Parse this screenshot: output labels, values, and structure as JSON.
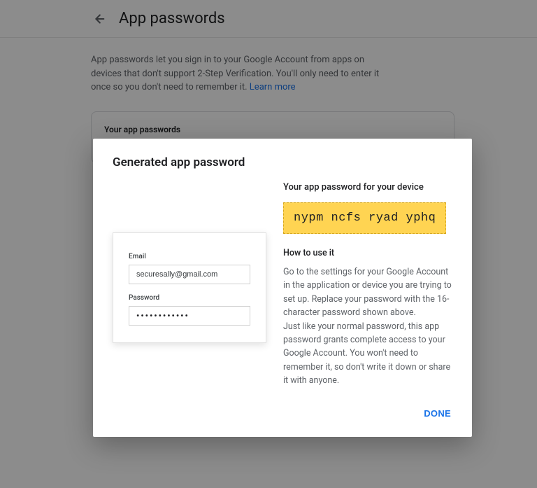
{
  "header": {
    "title": "App passwords"
  },
  "page": {
    "description": "App passwords let you sign in to your Google Account from apps on devices that don't support 2-Step Verification. You'll only need to enter it once so you don't need to remember it. ",
    "learn_more": "Learn more",
    "card_title": "Your app passwords"
  },
  "modal": {
    "title": "Generated app password",
    "sample": {
      "email_label": "Email",
      "email_value": "securesally@gmail.com",
      "password_label": "Password",
      "password_value": "••••••••••••"
    },
    "right": {
      "subhead": "Your app password for your device",
      "generated_password": "nypm ncfs ryad yphq",
      "howto_heading": "How to use it",
      "instructions_line1": "Go to the settings for your Google Account in the application or device you are trying to set up. Replace your password with the 16-character password shown above.",
      "instructions_line2": "Just like your normal password, this app password grants complete access to your Google Account. You won't need to remember it, so don't write it down or share it with anyone."
    },
    "done_label": "DONE"
  }
}
